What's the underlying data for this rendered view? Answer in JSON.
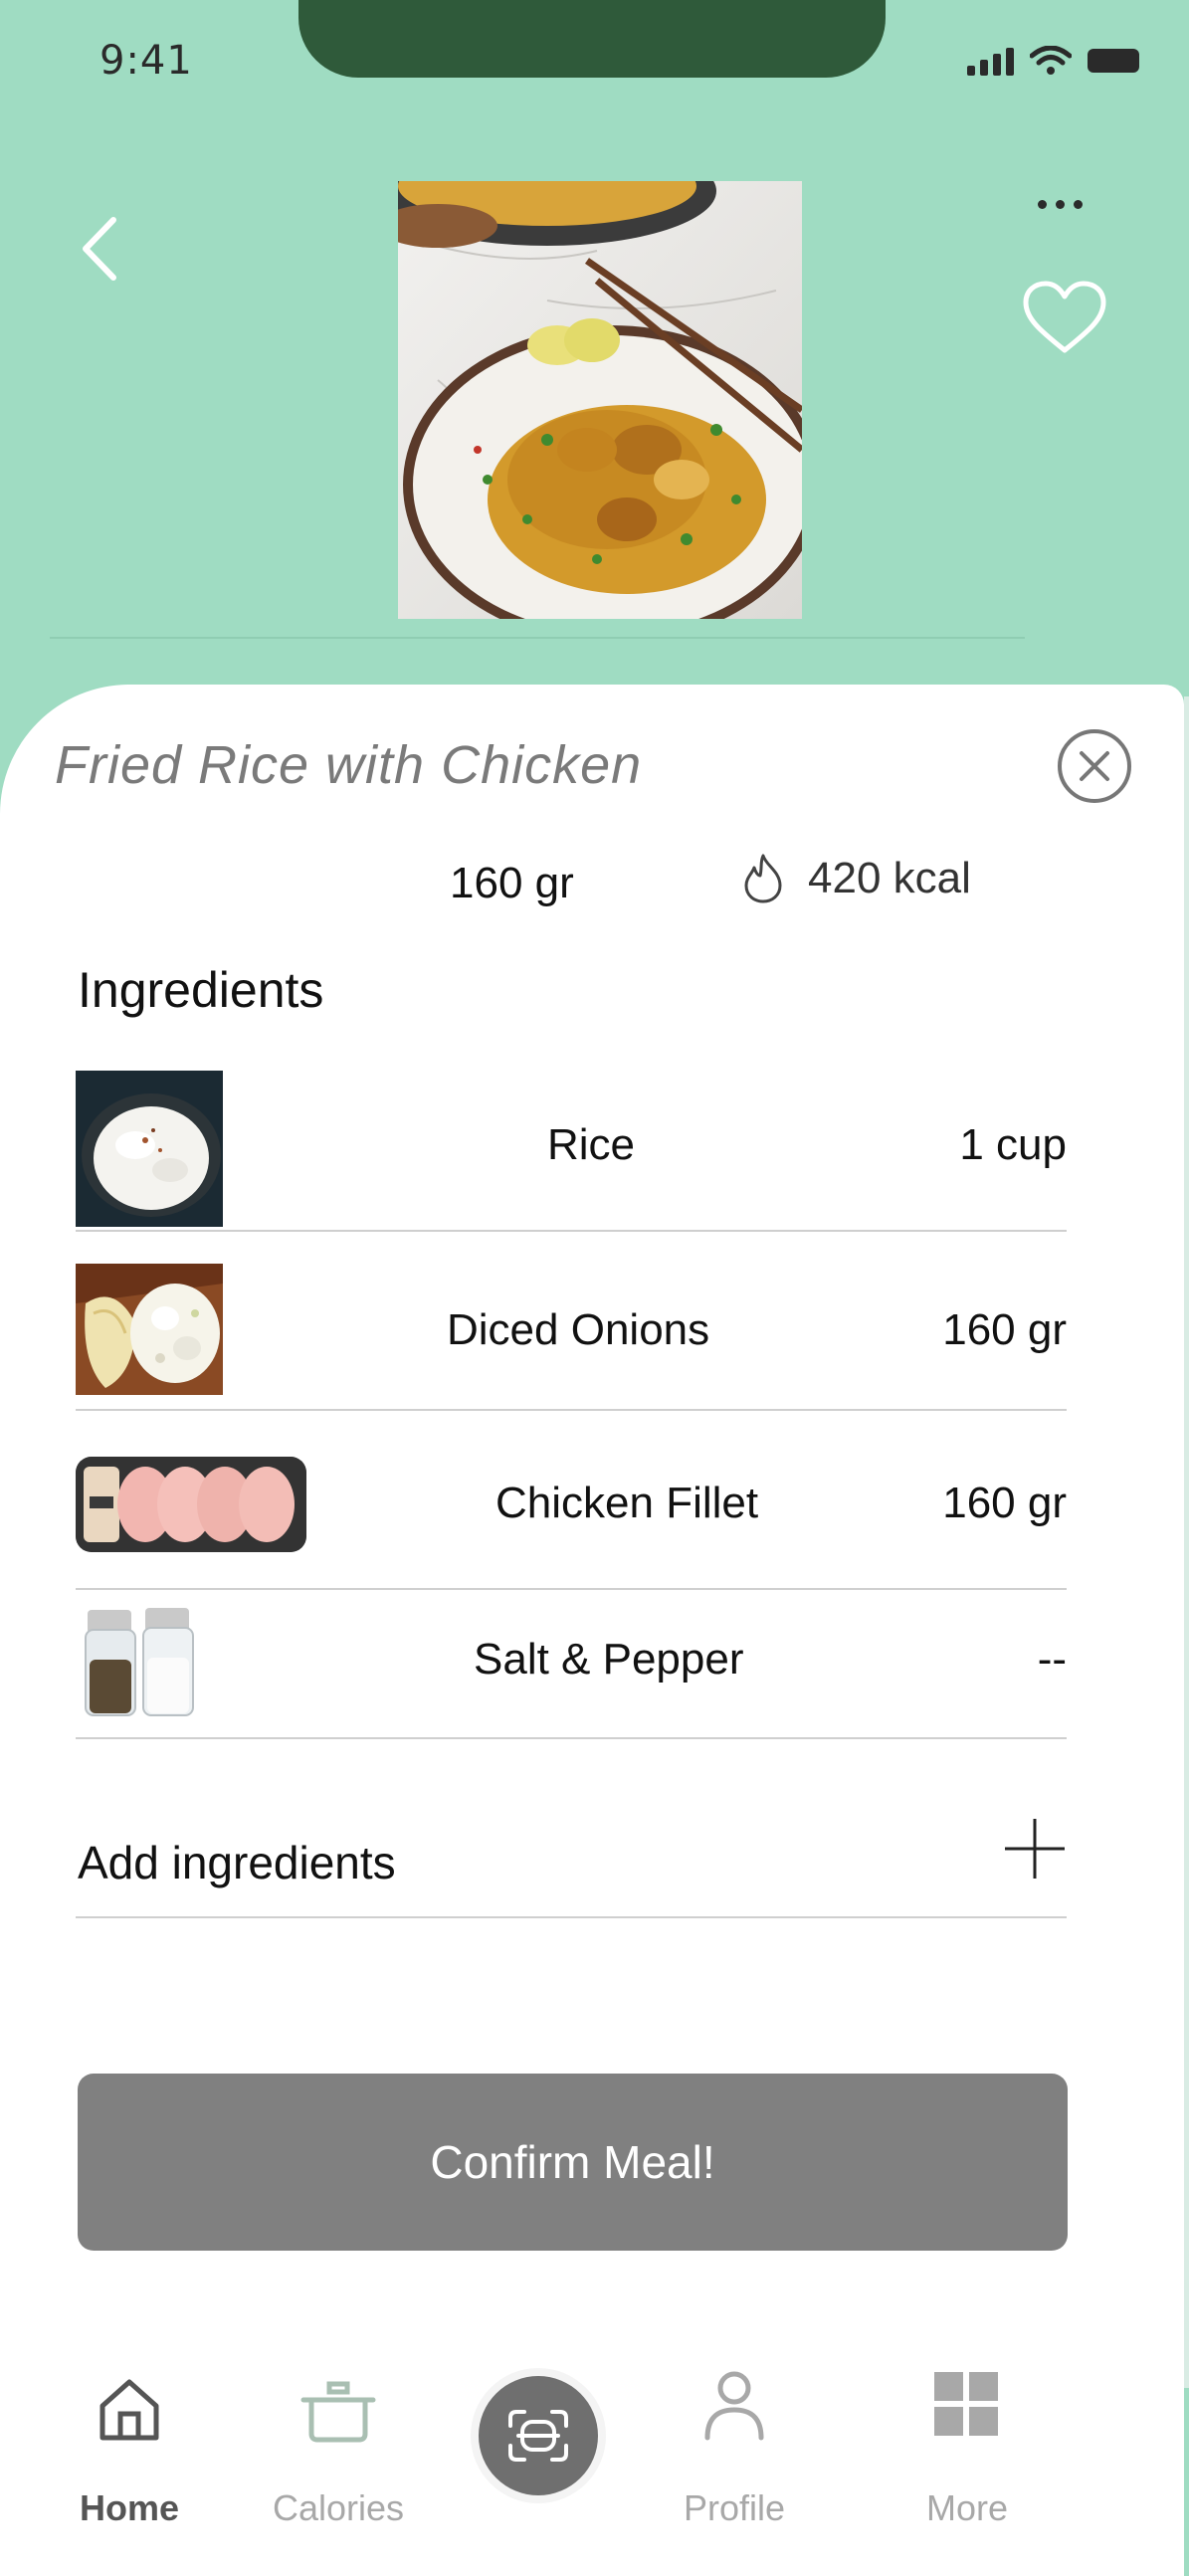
{
  "status_bar": {
    "time": "9:41"
  },
  "meal": {
    "title": "Fried Rice with Chicken",
    "weight": "160 gr",
    "calories": "420 kcal"
  },
  "ingredients": {
    "title": "Ingredients",
    "items": [
      {
        "name": "Rice",
        "quantity": "1 cup"
      },
      {
        "name": "Diced Onions",
        "quantity": "160 gr"
      },
      {
        "name": "Chicken Fillet",
        "quantity": "160 gr"
      },
      {
        "name": "Salt & Pepper",
        "quantity": "--"
      }
    ],
    "add_label": "Add ingredients"
  },
  "confirm_label": "Confirm Meal!",
  "nav": {
    "items": [
      {
        "label": "Home",
        "icon": "home-icon",
        "active": true
      },
      {
        "label": "Calories",
        "icon": "pot-icon",
        "active": false
      },
      {
        "label": "Profile",
        "icon": "person-icon",
        "active": false
      },
      {
        "label": "More",
        "icon": "grid-icon",
        "active": false
      }
    ],
    "scan_icon": "scan-icon"
  },
  "colors": {
    "background": "#9fdcc2",
    "sheet": "#ffffff",
    "confirm_button": "#808080",
    "notch": "#2f5a3a",
    "nav_active": "#555555",
    "nav_inactive": "#a8a8a8"
  }
}
